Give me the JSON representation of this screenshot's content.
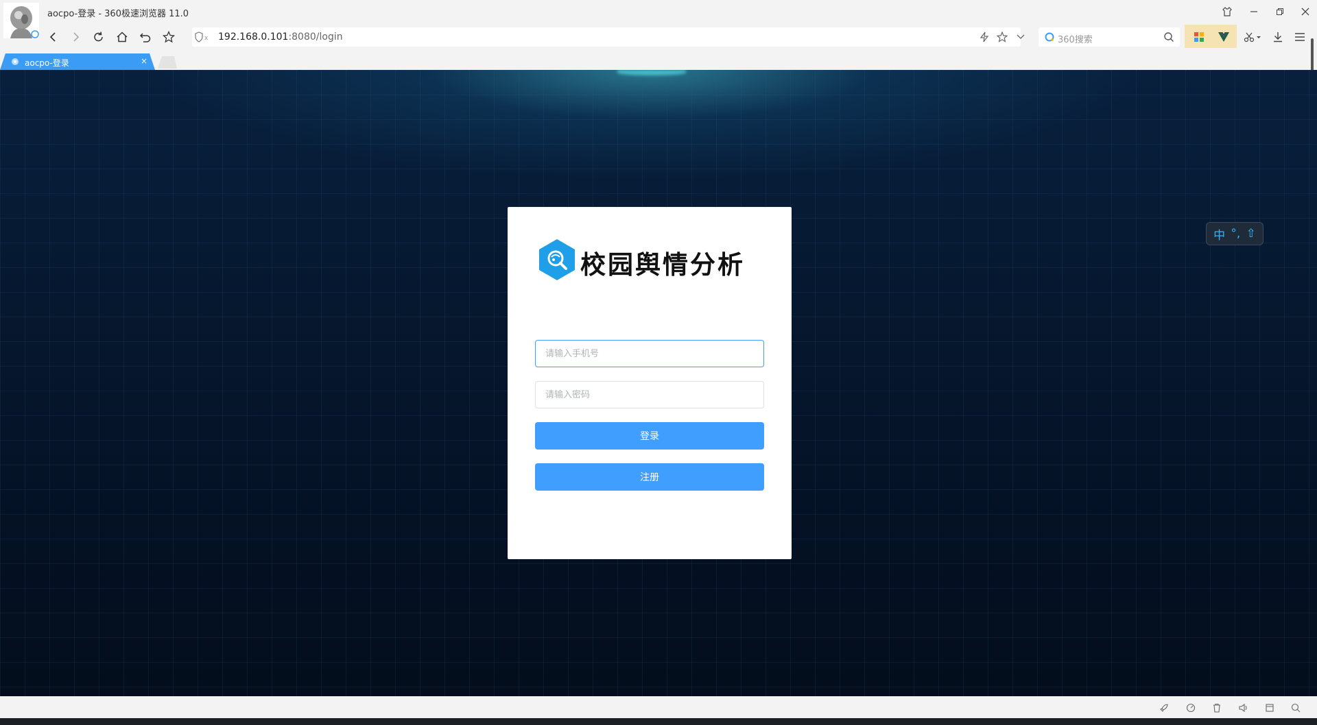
{
  "window": {
    "title": "aocpo-登录 - 360极速浏览器 11.0"
  },
  "toolbar": {
    "url_host": "192.168.0.101",
    "url_rest": ":8080/login",
    "search_placeholder": "360搜索"
  },
  "tabs": [
    {
      "label": "aocpo-登录",
      "close": "×"
    }
  ],
  "login": {
    "app_title": "校园舆情分析",
    "phone_placeholder": "请输入手机号",
    "password_placeholder": "请输入密码",
    "login_label": "登录",
    "register_label": "注册"
  },
  "ime": {
    "lang": "中",
    "punct": "°,",
    "shift": "⇧"
  },
  "colors": {
    "accent": "#409eff",
    "tab_active": "#3b9cf5",
    "logo": "#1e9fe8"
  }
}
